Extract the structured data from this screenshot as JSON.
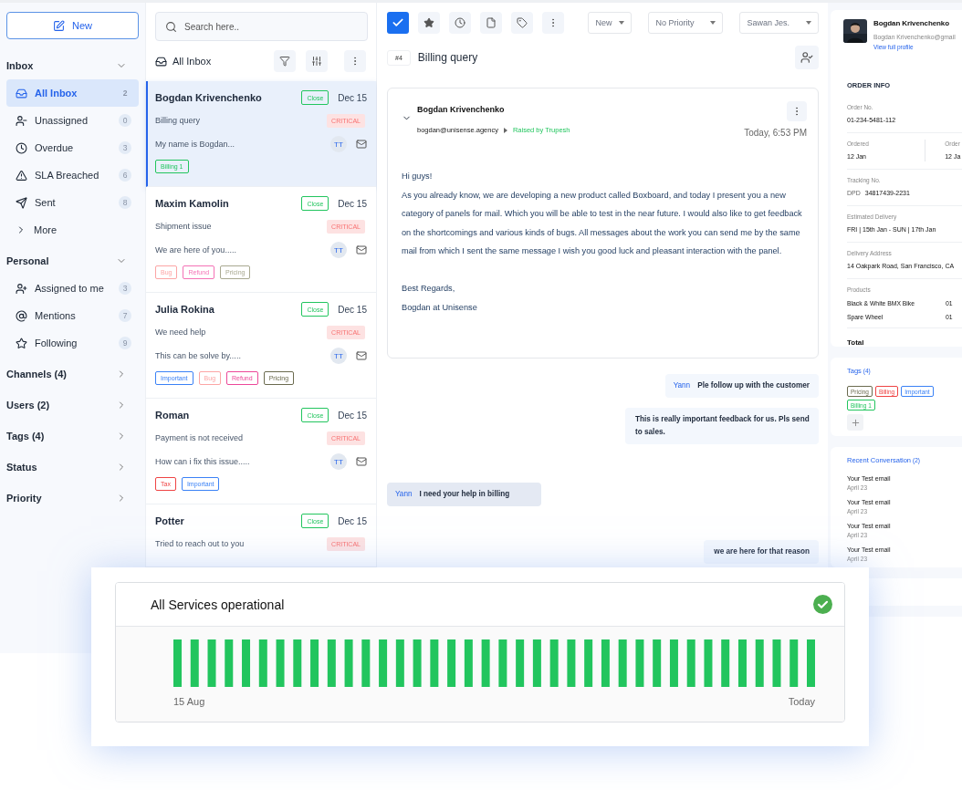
{
  "sidebar": {
    "new_button": "New",
    "sections": [
      {
        "title": "Inbox",
        "expanded": true,
        "items": [
          {
            "label": "All Inbox",
            "count": "2",
            "selected": true
          },
          {
            "label": "Unassigned",
            "count": "0",
            "selected": false
          },
          {
            "label": "Overdue",
            "count": "3",
            "selected": false
          },
          {
            "label": "SLA Breached",
            "count": "6",
            "selected": false
          },
          {
            "label": "Sent",
            "count": "8",
            "selected": false
          }
        ],
        "more": "More"
      },
      {
        "title": "Personal",
        "expanded": true,
        "items": [
          {
            "label": "Assigned to me",
            "count": "3",
            "selected": false
          },
          {
            "label": "Mentions",
            "count": "7",
            "selected": false
          },
          {
            "label": "Following",
            "count": "9",
            "selected": false
          }
        ]
      },
      {
        "title": "Channels (4)",
        "expanded": false
      },
      {
        "title": "Users (2)",
        "expanded": false
      },
      {
        "title": "Tags (4)",
        "expanded": false
      },
      {
        "title": "Status",
        "expanded": false
      },
      {
        "title": "Priority",
        "expanded": false
      }
    ]
  },
  "ticket_list": {
    "search": {
      "placeholder": "Search here.."
    },
    "title": "All Inbox",
    "tickets": [
      {
        "name": "Bogdan Krivenchenko",
        "status": "Close",
        "date": "Dec 15",
        "subject": "Billing query",
        "priority": "CRITICAL",
        "preview": "My name is Bogdan...",
        "avatar": "TT",
        "selected": true,
        "tags": [
          {
            "label": "Billing 1",
            "color": "#22c55e"
          }
        ]
      },
      {
        "name": "Maxim Kamolin",
        "status": "Close",
        "date": "Dec 15",
        "subject": "Shipment issue",
        "priority": "CRITICAL",
        "preview": "We are here of you.....",
        "avatar": "TT",
        "selected": false,
        "tags": [
          {
            "label": "Bug",
            "color": "#fca5a5"
          },
          {
            "label": "Refund",
            "color": "#f472b6"
          },
          {
            "label": "Pricing",
            "color": "#a8a890"
          }
        ]
      },
      {
        "name": "Julia Rokina",
        "status": "Close",
        "date": "Dec 15",
        "subject": "We need help",
        "priority": "CRITICAL",
        "preview": "This can be solve by.....",
        "avatar": "TT",
        "selected": false,
        "tags": [
          {
            "label": "Important",
            "color": "#3b82f6"
          },
          {
            "label": "Bug",
            "color": "#fca5a5"
          },
          {
            "label": "Refund",
            "color": "#ec4899"
          },
          {
            "label": "Pricing",
            "color": "#6b6b4f"
          }
        ]
      },
      {
        "name": "Roman",
        "status": "Close",
        "date": "Dec 15",
        "subject": "Payment is not received",
        "priority": "CRITICAL",
        "preview": "How can i fix this issue.....",
        "avatar": "TT",
        "selected": false,
        "tags": [
          {
            "label": "Tax",
            "color": "#ef4444"
          },
          {
            "label": "Important",
            "color": "#3b82f6"
          }
        ]
      },
      {
        "name": "Potter",
        "status": "Close",
        "date": "Dec 15",
        "subject": "Tried to reach out to you",
        "priority": "CRITICAL",
        "selected": false
      }
    ]
  },
  "conversation": {
    "done_checked": true,
    "dropdowns": [
      "New",
      "No Priority",
      "Sawan Jes."
    ],
    "number": "#4",
    "title": "Billing query",
    "email": {
      "sender": "Bogdan Krivenchenko",
      "address": "bogdan@unisense.agency",
      "raised_by": "Raised by Trupesh",
      "time": "Today, 6:53 PM",
      "body": [
        "Hi guys!",
        "As you already know, we are developing a new product called Boxboard, and today I present you a new category of panels for mail. Which you will be able to test in the near future. I would also like to get feedback on the shortcomings and various kinds of bugs. All messages about the work you can send me by the same mail from which I sent the same message I wish you good luck and pleasant interaction with the panel."
      ],
      "signoff": [
        "Best Regards,",
        "Bogdan at Unisense"
      ]
    },
    "messages": [
      {
        "kind": "outgoing",
        "author": "Yann",
        "text": "Ple follow up with the customer"
      },
      {
        "kind": "outgoing",
        "text": "This is really important feedback for us. Pls send to sales."
      },
      {
        "kind": "incoming",
        "author": "Yann",
        "text": "I need your help in billing"
      },
      {
        "kind": "outgoing",
        "text": "we are here for that reason"
      }
    ]
  },
  "details": {
    "profile": {
      "name": "Bogdan Krivenchenko",
      "email": "Bogdan Krivenchenko@gmail",
      "link": "View full profile"
    },
    "order": {
      "title": "ORDER INFO",
      "fields": [
        {
          "kind": "single",
          "label": "Order No.",
          "value": "01-234-5481-112"
        },
        {
          "kind": "pair",
          "items": [
            {
              "label": "Ordered",
              "value": "12 Jan"
            },
            {
              "label": "Order",
              "value": "12 Ja"
            }
          ]
        },
        {
          "kind": "tracking",
          "label": "Tracking No.",
          "carrier": "DPD",
          "value": "34817439-2231"
        },
        {
          "kind": "single",
          "label": "Estimated Delivery",
          "value": "FRI  |  15th Jan - SUN  |  17th Jan"
        },
        {
          "kind": "single",
          "label": "Delivery Address",
          "value": "14 Oakpark Road, San Francisco, CA"
        },
        {
          "kind": "products",
          "label": "Products",
          "items": [
            {
              "name": "Black & White BMX Bike",
              "qty": "01"
            },
            {
              "name": "Spare Wheel",
              "qty": "01"
            }
          ]
        },
        {
          "kind": "total",
          "label": "Total"
        }
      ]
    },
    "tags": {
      "title": "Tags",
      "count": "(4)",
      "items": [
        {
          "label": "Pricing",
          "color": "#6b6b4f"
        },
        {
          "label": "Billing",
          "color": "#ef4444"
        },
        {
          "label": "Important",
          "color": "#3b82f6"
        },
        {
          "label": "Billing 1",
          "color": "#22c55e"
        }
      ]
    },
    "recent": {
      "title": "Recent Conversation",
      "count": "(2)",
      "items": [
        {
          "subject": "Your Test email",
          "date": "April 23"
        },
        {
          "subject": "Your Test email",
          "date": "April 23"
        },
        {
          "subject": "Your Test email",
          "date": "April 23"
        },
        {
          "subject": "Your Test email",
          "date": "April 23"
        }
      ]
    }
  },
  "status_card": {
    "title": "All Services operational",
    "operational": true,
    "start_label": "15 Aug",
    "end_label": "Today"
  }
}
